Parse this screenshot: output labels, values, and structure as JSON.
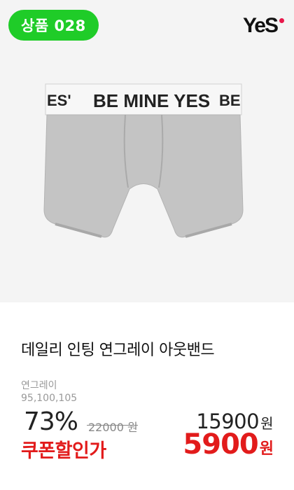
{
  "badge": {
    "label": "상품 028",
    "color": "#1fcc28"
  },
  "brand": {
    "name": "YeS",
    "dot_color": "#e8174a"
  },
  "product": {
    "waistband_text": "BE MINE YES",
    "waistband_left_text": "ES'",
    "waistband_right_text": "BE",
    "title": "데일리 인팅 연그레이 아웃밴드",
    "color_option": "연그레이",
    "sizes": "95,100,105"
  },
  "pricing": {
    "discount_rate": "73%",
    "original_price": "22000 원",
    "sale_price": "15900",
    "sale_unit": "원",
    "coupon_label": "쿠폰할인가",
    "coupon_price": "5900",
    "coupon_unit": "원",
    "accent_red": "#e21b1b"
  }
}
